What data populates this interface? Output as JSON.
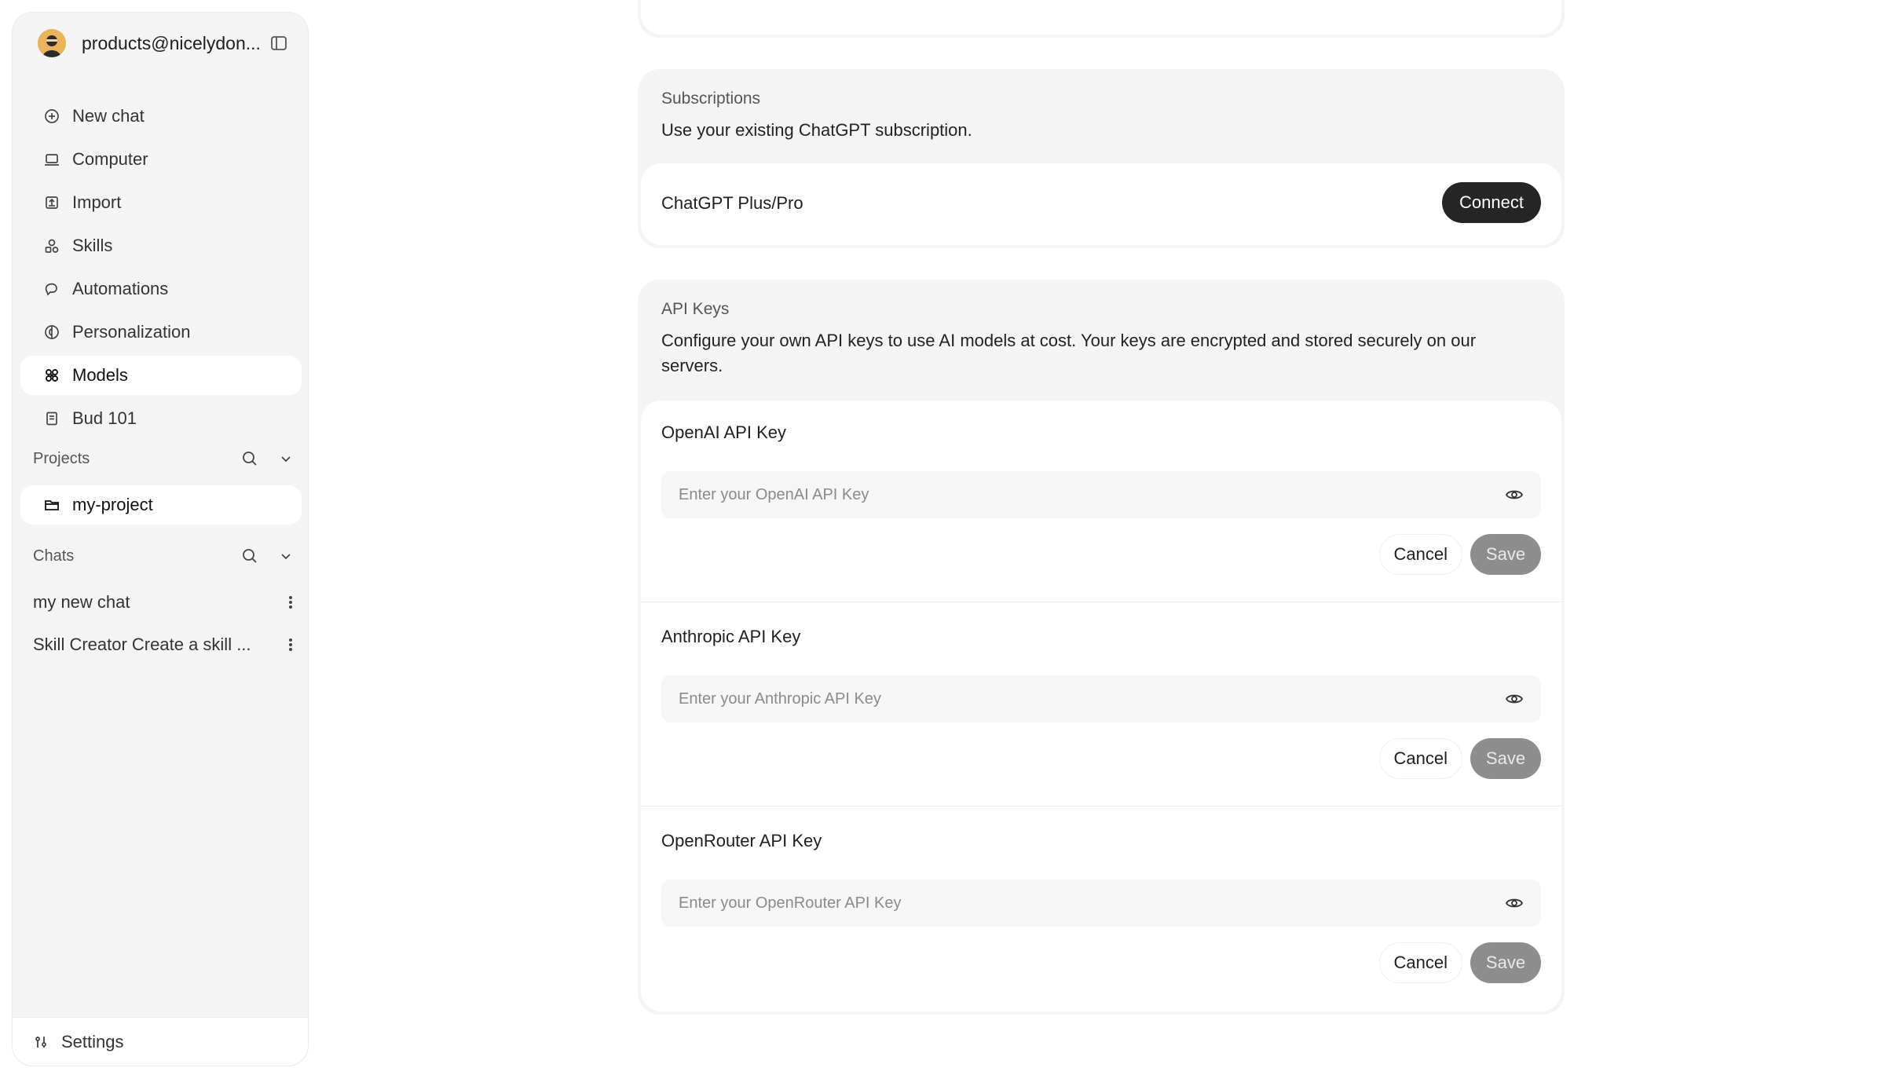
{
  "sidebar": {
    "account": {
      "email": "products@nicelydon..."
    },
    "nav": [
      {
        "label": "New chat",
        "icon": "plus-circle-icon"
      },
      {
        "label": "Computer",
        "icon": "laptop-icon"
      },
      {
        "label": "Import",
        "icon": "import-icon"
      },
      {
        "label": "Skills",
        "icon": "shapes-icon"
      },
      {
        "label": "Automations",
        "icon": "automation-icon"
      },
      {
        "label": "Personalization",
        "icon": "personalization-icon"
      },
      {
        "label": "Models",
        "icon": "models-icon",
        "active": true
      },
      {
        "label": "Bud 101",
        "icon": "book-icon"
      }
    ],
    "projects": {
      "title": "Projects",
      "items": [
        "my-project"
      ]
    },
    "chats": {
      "title": "Chats",
      "items": [
        "my new chat",
        "Skill Creator Create a skill ..."
      ]
    },
    "footer": {
      "settings_label": "Settings"
    }
  },
  "main": {
    "subscriptions": {
      "label": "Subscriptions",
      "description": "Use your existing ChatGPT subscription.",
      "plan_name": "ChatGPT Plus/Pro",
      "connect_label": "Connect"
    },
    "api_keys": {
      "label": "API Keys",
      "description": "Configure your own API keys to use AI models at cost. Your keys are encrypted and stored securely on our servers.",
      "keys": [
        {
          "title": "OpenAI API Key",
          "placeholder": "Enter your OpenAI API Key",
          "value": "",
          "cancel_label": "Cancel",
          "save_label": "Save"
        },
        {
          "title": "Anthropic API Key",
          "placeholder": "Enter your Anthropic API Key",
          "value": "",
          "cancel_label": "Cancel",
          "save_label": "Save"
        },
        {
          "title": "OpenRouter API Key",
          "placeholder": "Enter your OpenRouter API Key",
          "value": "",
          "cancel_label": "Cancel",
          "save_label": "Save"
        }
      ]
    }
  },
  "colors": {
    "sidebar_bg": "#f4f4f4",
    "primary_button": "#252525",
    "disabled_button": "#8d8d8d"
  }
}
